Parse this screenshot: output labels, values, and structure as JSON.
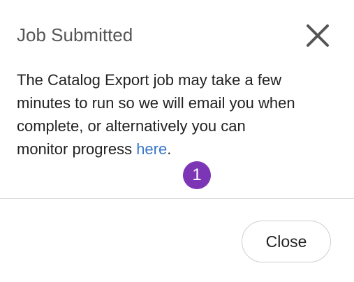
{
  "dialog": {
    "title": "Job Submitted",
    "close_icon": "close-x-icon",
    "message": {
      "line1": "The Catalog Export job may take a few",
      "line2": "minutes to run so we will email you when",
      "line3": "complete, or alternatively you can",
      "line4_prefix": "monitor progress ",
      "link_text": "here",
      "line4_suffix": "."
    },
    "annotation_badge": "1",
    "close_button_label": "Close"
  },
  "colors": {
    "link": "#3a78c9",
    "badge": "#7b35b5",
    "title": "#555555",
    "divider": "#d9d9d9"
  }
}
